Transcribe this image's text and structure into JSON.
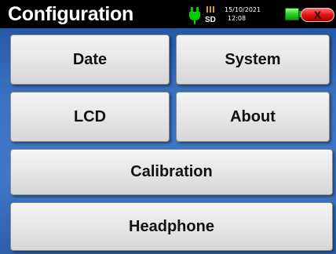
{
  "header": {
    "title": "Configuration",
    "sd_label": "SD",
    "date": "15/10/2021",
    "time": "12:08",
    "close_label": "X"
  },
  "icons": {
    "power": "power-plug-icon",
    "sd": "sd-card-icon",
    "battery": "battery-icon",
    "close": "close-icon"
  },
  "buttons": {
    "date": "Date",
    "system": "System",
    "lcd": "LCD",
    "about": "About",
    "calibration": "Calibration",
    "headphone": "Headphone"
  },
  "colors": {
    "background": "#3f78c8",
    "topbar": "#000000",
    "button": "#e8e8e8",
    "power_plug": "#00cc00",
    "battery": "#32d42a",
    "close": "#e21515"
  },
  "status": {
    "battery_level": 1.0
  }
}
